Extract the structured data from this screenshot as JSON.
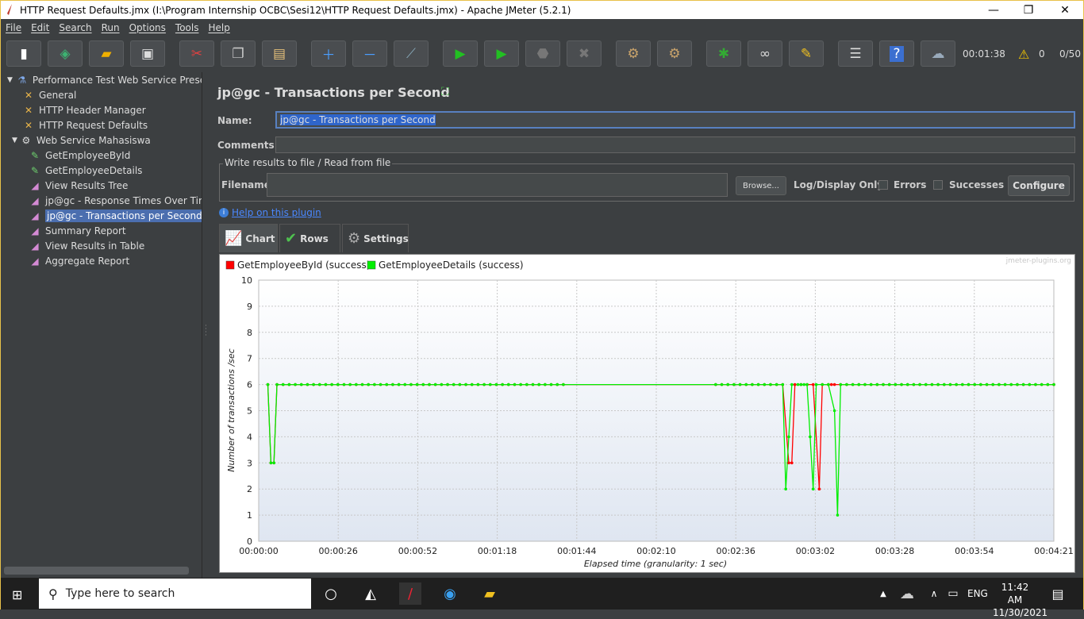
{
  "window": {
    "title": "HTTP Request Defaults.jmx (I:\\Program Internship OCBC\\Sesi12\\HTTP Request Defaults.jmx) - Apache JMeter (5.2.1)"
  },
  "menu": [
    "File",
    "Edit",
    "Search",
    "Run",
    "Options",
    "Tools",
    "Help"
  ],
  "toolbar": {
    "icons": [
      "new-icon",
      "templates-icon",
      "open-icon",
      "save-icon",
      "cut-icon",
      "copy-icon",
      "paste-icon",
      "expand-all-icon",
      "collapse-all-icon",
      "toggle-icon",
      "start-icon",
      "start-no-pauses-icon",
      "stop-icon",
      "shutdown-icon",
      "clear-icon",
      "clear-all-icon",
      "remote-icon",
      "search-icon",
      "reset-search-icon",
      "function-helper-icon",
      "help-icon",
      "logger-icon"
    ],
    "timer": "00:01:38",
    "warning_count": "0",
    "threads": "0/50"
  },
  "tree": {
    "items": [
      {
        "label": "Performance Test Web Service Preser",
        "icon": "flask-icon",
        "level": 0
      },
      {
        "label": "General",
        "icon": "config-tool-icon",
        "level": 1
      },
      {
        "label": "HTTP Header Manager",
        "icon": "config-tool-icon",
        "level": 1
      },
      {
        "label": "HTTP Request Defaults",
        "icon": "config-tool-icon",
        "level": 1
      },
      {
        "label": "Web Service Mahasiswa",
        "icon": "gear-icon",
        "level": 1
      },
      {
        "label": "GetEmployeeById",
        "icon": "pipette-icon",
        "level": 2
      },
      {
        "label": "GetEmployeeDetails",
        "icon": "pipette-icon",
        "level": 2
      },
      {
        "label": "View Results Tree",
        "icon": "listener-icon",
        "level": 2
      },
      {
        "label": "jp@gc - Response Times Over Tim",
        "icon": "listener-icon",
        "level": 2
      },
      {
        "label": "jp@gc - Transactions per Second",
        "icon": "listener-icon",
        "level": 2,
        "selected": true
      },
      {
        "label": "Summary Report",
        "icon": "listener-icon",
        "level": 2
      },
      {
        "label": "View Results in Table",
        "icon": "listener-icon",
        "level": 2
      },
      {
        "label": "Aggregate Report",
        "icon": "listener-icon",
        "level": 2
      }
    ]
  },
  "panel": {
    "title": "jp@gc - Transactions per Second",
    "name_label": "Name:",
    "name_value": "jp@gc - Transactions per Second",
    "comments_label": "Comments:",
    "comments_value": "",
    "file_group_title": "Write results to file / Read from file",
    "filename_label": "Filename",
    "filename_value": "",
    "browse_label": "Browse...",
    "log_display_label": "Log/Display Only:",
    "errors_label": "Errors",
    "successes_label": "Successes",
    "configure_label": "Configure",
    "help_link": "Help on this plugin",
    "tabs": [
      "Chart",
      "Rows",
      "Settings"
    ]
  },
  "chart_data": {
    "type": "line",
    "watermark": "jmeter-plugins.org",
    "xlabel": "Elapsed time (granularity: 1 sec)",
    "ylabel": "Number of transactions /sec",
    "ylim": [
      0,
      10
    ],
    "xlim_sec": [
      0,
      261
    ],
    "x_ticks": [
      "00:00:00",
      "00:00:26",
      "00:00:52",
      "00:01:18",
      "00:01:44",
      "00:02:10",
      "00:02:36",
      "00:03:02",
      "00:03:28",
      "00:03:54",
      "00:04:21"
    ],
    "y_ticks": [
      0,
      1,
      2,
      3,
      4,
      5,
      6,
      7,
      8,
      9,
      10
    ],
    "grid": true,
    "legend": "top-left",
    "series": [
      {
        "name": "GetEmployeeById (success)",
        "color": "#ff0000",
        "points": [
          [
            3,
            6
          ],
          [
            4,
            3
          ],
          [
            5,
            3
          ],
          [
            6,
            6
          ],
          [
            100,
            6
          ],
          [
            150,
            6
          ],
          [
            160,
            6
          ],
          [
            170,
            6
          ],
          [
            172,
            6
          ],
          [
            174,
            3
          ],
          [
            175,
            3
          ],
          [
            176,
            6
          ],
          [
            180,
            6
          ],
          [
            182,
            6
          ],
          [
            184,
            2
          ],
          [
            185,
            6
          ],
          [
            187,
            6
          ],
          [
            188,
            6
          ],
          [
            189,
            6
          ],
          [
            191,
            6
          ],
          [
            261,
            6
          ]
        ]
      },
      {
        "name": "GetEmployeeDetails (success)",
        "color": "#00ee00",
        "points": [
          [
            3,
            6
          ],
          [
            4,
            3
          ],
          [
            5,
            3
          ],
          [
            6,
            6
          ],
          [
            100,
            6
          ],
          [
            150,
            6
          ],
          [
            160,
            6
          ],
          [
            170,
            6
          ],
          [
            172,
            6
          ],
          [
            173,
            2
          ],
          [
            174,
            4
          ],
          [
            175,
            6
          ],
          [
            177,
            6
          ],
          [
            178,
            6
          ],
          [
            179,
            6
          ],
          [
            180,
            6
          ],
          [
            181,
            4
          ],
          [
            182,
            2
          ],
          [
            183,
            6
          ],
          [
            185,
            6
          ],
          [
            187,
            6
          ],
          [
            189,
            5
          ],
          [
            190,
            1
          ],
          [
            191,
            6
          ],
          [
            261,
            6
          ]
        ]
      }
    ]
  },
  "taskbar": {
    "search_placeholder": "Type here to search",
    "lang": "ENG",
    "time": "11:42 AM",
    "date": "11/30/2021"
  }
}
